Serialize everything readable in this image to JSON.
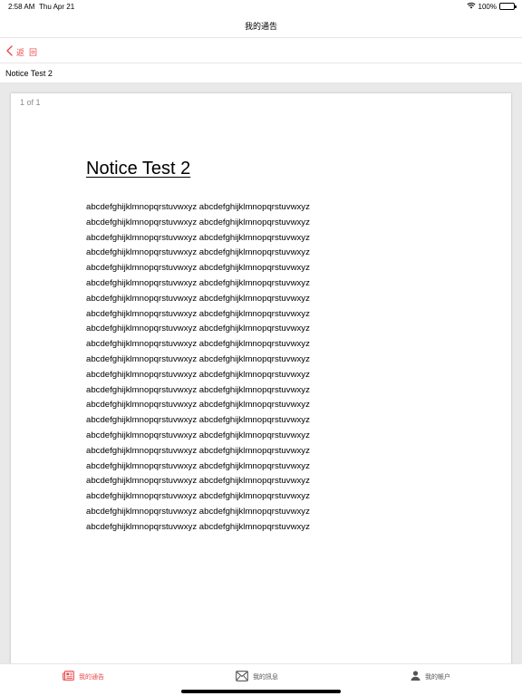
{
  "status_bar": {
    "time": "2:58 AM",
    "date": "Thu Apr 21",
    "battery": "100%"
  },
  "nav": {
    "title": "我的通告"
  },
  "back": {
    "label": "返回"
  },
  "notice": {
    "title": "Notice Test 2"
  },
  "document": {
    "page_indicator": "1 of 1",
    "heading": "Notice Test 2",
    "lines": [
      "abcdefghijklmnopqrstuvwxyz abcdefghijklmnopqrstuvwxyz",
      "abcdefghijklmnopqrstuvwxyz abcdefghijklmnopqrstuvwxyz",
      "abcdefghijklmnopqrstuvwxyz abcdefghijklmnopqrstuvwxyz",
      "abcdefghijklmnopqrstuvwxyz abcdefghijklmnopqrstuvwxyz",
      "abcdefghijklmnopqrstuvwxyz abcdefghijklmnopqrstuvwxyz",
      "abcdefghijklmnopqrstuvwxyz abcdefghijklmnopqrstuvwxyz",
      "abcdefghijklmnopqrstuvwxyz abcdefghijklmnopqrstuvwxyz",
      "abcdefghijklmnopqrstuvwxyz abcdefghijklmnopqrstuvwxyz",
      "abcdefghijklmnopqrstuvwxyz abcdefghijklmnopqrstuvwxyz",
      "abcdefghijklmnopqrstuvwxyz abcdefghijklmnopqrstuvwxyz",
      "abcdefghijklmnopqrstuvwxyz abcdefghijklmnopqrstuvwxyz",
      "abcdefghijklmnopqrstuvwxyz abcdefghijklmnopqrstuvwxyz",
      "abcdefghijklmnopqrstuvwxyz abcdefghijklmnopqrstuvwxyz",
      "abcdefghijklmnopqrstuvwxyz abcdefghijklmnopqrstuvwxyz",
      "abcdefghijklmnopqrstuvwxyz abcdefghijklmnopqrstuvwxyz",
      "abcdefghijklmnopqrstuvwxyz abcdefghijklmnopqrstuvwxyz",
      "abcdefghijklmnopqrstuvwxyz abcdefghijklmnopqrstuvwxyz",
      "abcdefghijklmnopqrstuvwxyz abcdefghijklmnopqrstuvwxyz",
      "abcdefghijklmnopqrstuvwxyz abcdefghijklmnopqrstuvwxyz",
      "abcdefghijklmnopqrstuvwxyz abcdefghijklmnopqrstuvwxyz",
      "abcdefghijklmnopqrstuvwxyz abcdefghijklmnopqrstuvwxyz",
      "abcdefghijklmnopqrstuvwxyz abcdefghijklmnopqrstuvwxyz"
    ]
  },
  "tabs": {
    "notices": {
      "label": "我的通告",
      "icon": "newspaper-icon",
      "active": true
    },
    "messages": {
      "label": "我的訊息",
      "icon": "envelope-icon",
      "active": false
    },
    "account": {
      "label": "我的帳户",
      "icon": "person-icon",
      "active": false
    }
  },
  "colors": {
    "accent": "#e84a4a",
    "viewer_background": "#e9e9e9",
    "divider": "#e6e6e6"
  }
}
